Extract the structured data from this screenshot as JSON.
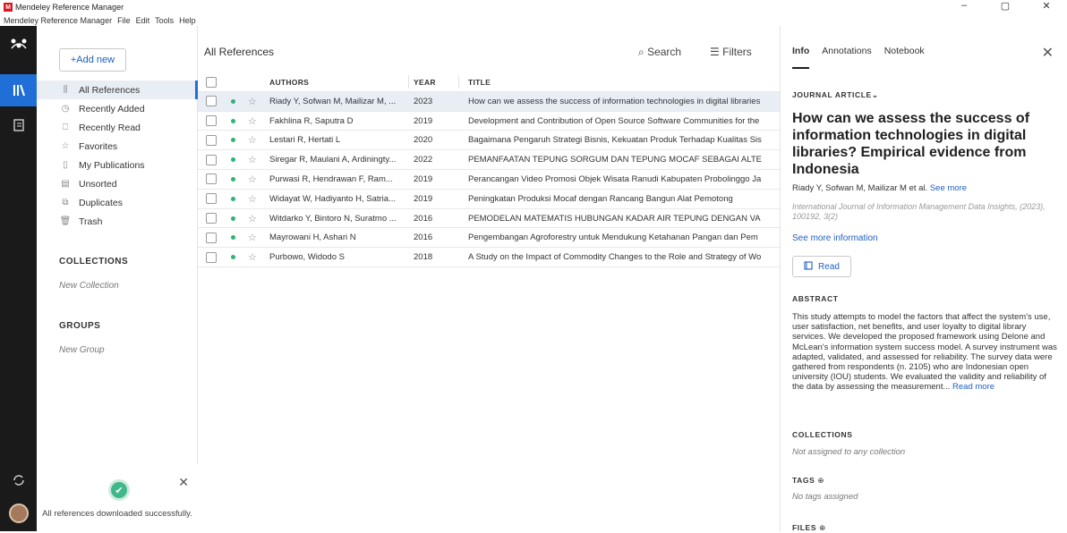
{
  "window": {
    "app_title": "Mendeley Reference Manager",
    "logo_text": "M",
    "controls": [
      "–",
      "▢",
      "✕"
    ]
  },
  "menu": {
    "items": [
      "Mendeley Reference Manager",
      "File",
      "Edit",
      "Tools",
      "Help"
    ]
  },
  "sidebar": {
    "add_new": "+Add new",
    "nav": [
      {
        "icon": "library-icon",
        "glyph": "⫼",
        "label": "All References"
      },
      {
        "icon": "clock-icon",
        "glyph": "◷",
        "label": "Recently Added"
      },
      {
        "icon": "bookmark-icon",
        "glyph": "⎕",
        "label": "Recently Read"
      },
      {
        "icon": "star-icon",
        "glyph": "☆",
        "label": "Favorites"
      },
      {
        "icon": "publications-icon",
        "glyph": "▯",
        "label": "My Publications"
      },
      {
        "icon": "unsorted-icon",
        "glyph": "▤",
        "label": "Unsorted"
      },
      {
        "icon": "duplicates-icon",
        "glyph": "⧉",
        "label": "Duplicates"
      },
      {
        "icon": "trash-icon",
        "glyph": "🗑",
        "label": "Trash"
      }
    ],
    "collections_title": "COLLECTIONS",
    "new_collection": "New Collection",
    "groups_title": "GROUPS",
    "new_group": "New Group",
    "toast": "All references downloaded successfully."
  },
  "main": {
    "title": "All References",
    "search": "Search",
    "filters": "Filters",
    "columns": {
      "authors": "AUTHORS",
      "year": "YEAR",
      "title": "TITLE"
    },
    "rows": [
      {
        "authors": "Riady Y, Sofwan M, Mailizar M, ...",
        "year": "2023",
        "title": "How can we assess the success of information technologies in digital libraries"
      },
      {
        "authors": "Fakhlina R, Saputra D",
        "year": "2019",
        "title": "Development and Contribution of Open Source Software Communities for the"
      },
      {
        "authors": "Lestari R, Hertati L",
        "year": "2020",
        "title": "Bagaimana Pengaruh Strategi Bisnis, Kekuatan Produk Terhadap Kualitas Sis"
      },
      {
        "authors": "Siregar R, Maulani A, Ardiningty...",
        "year": "2022",
        "title": "PEMANFAATAN TEPUNG SORGUM DAN TEPUNG MOCAF SEBAGAI ALTE"
      },
      {
        "authors": "Purwasi R, Hendrawan F, Ram...",
        "year": "2019",
        "title": "Perancangan Video Promosi Objek Wisata Ranudi Kabupaten Probolinggo Ja"
      },
      {
        "authors": "Widayat W, Hadiyanto H, Satria...",
        "year": "2019",
        "title": "Peningkatan Produksi Mocaf dengan Rancang Bangun Alat Pemotong"
      },
      {
        "authors": "Witdarko Y, Bintoro N, Suratmo ...",
        "year": "2016",
        "title": "PEMODELAN MATEMATIS HUBUNGAN KADAR AIR TEPUNG DENGAN VA"
      },
      {
        "authors": "Mayrowani H, Ashari N",
        "year": "2016",
        "title": "Pengembangan Agroforestry untuk Mendukung Ketahanan Pangan dan Pem"
      },
      {
        "authors": "Purbowo, Widodo S",
        "year": "2018",
        "title": "A Study on the Impact of Commodity Changes to the Role and Strategy of Wo"
      }
    ]
  },
  "panel": {
    "tabs": [
      "Info",
      "Annotations",
      "Notebook"
    ],
    "type": "JOURNAL ARTICLE",
    "title": "How can we assess the success of information technologies in digital libraries? Empirical evidence from Indonesia",
    "authors": "Riady Y, Sofwan M, Mailizar M et al.",
    "see_more": "See more",
    "journal": "International Journal of Information Management Data Insights, (2023), 100192, 3(2)",
    "see_more_info": "See more information",
    "read": "Read",
    "abstract_label": "ABSTRACT",
    "abstract": "This study attempts to model the factors that affect the system's use, user satisfaction, net benefits, and user loyalty to digital library services. We developed the proposed framework using Delone and McLean's information system success model. A survey instrument was adapted, validated, and assessed for reliability. The survey data were gathered from respondents (n. 2105) who are Indonesian open university (IOU) students. We evaluated the validity and reliability of the data by assessing the measurement...",
    "read_more": "Read more",
    "collections_label": "COLLECTIONS",
    "collections_value": "Not assigned to any collection",
    "tags_label": "TAGS",
    "tags_value": "No tags assigned",
    "files_label": "FILES"
  }
}
